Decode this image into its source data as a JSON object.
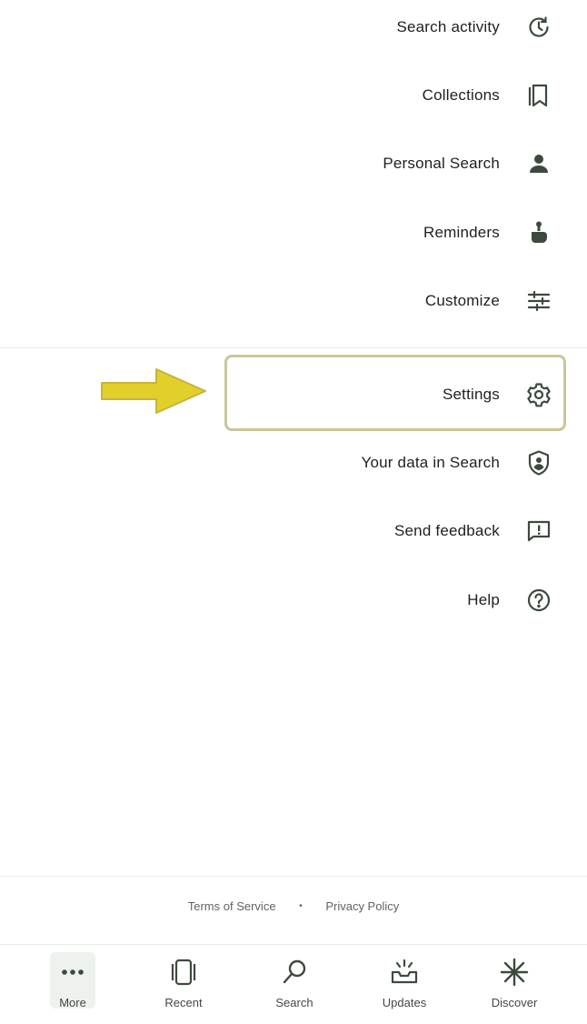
{
  "menu": {
    "items": [
      {
        "label": "Search activity",
        "icon": "history-icon"
      },
      {
        "label": "Collections",
        "icon": "bookmark-icon"
      },
      {
        "label": "Personal Search",
        "icon": "person-icon"
      },
      {
        "label": "Reminders",
        "icon": "reminder-icon"
      },
      {
        "label": "Customize",
        "icon": "tune-icon"
      },
      {
        "label": "Settings",
        "icon": "gear-icon"
      },
      {
        "label": "Your data in Search",
        "icon": "shield-person-icon"
      },
      {
        "label": "Send feedback",
        "icon": "feedback-icon"
      },
      {
        "label": "Help",
        "icon": "help-icon"
      }
    ]
  },
  "footer": {
    "privacy_policy": "Privacy Policy",
    "separator": "•",
    "terms_of_service": "Terms of Service"
  },
  "bottom_nav": {
    "items": [
      {
        "label": "Discover",
        "icon": "discover-icon"
      },
      {
        "label": "Updates",
        "icon": "updates-icon"
      },
      {
        "label": "Search",
        "icon": "search-icon"
      },
      {
        "label": "Recent",
        "icon": "recent-icon"
      },
      {
        "label": "More",
        "icon": "more-dots-icon",
        "active": true
      }
    ]
  },
  "colors": {
    "icon": "#3c4a3e",
    "highlight_border": "#c9c79a",
    "arrow_fill": "#e3cf2a",
    "arrow_stroke": "#c5b43a",
    "active_pill": "#eef2ef"
  }
}
